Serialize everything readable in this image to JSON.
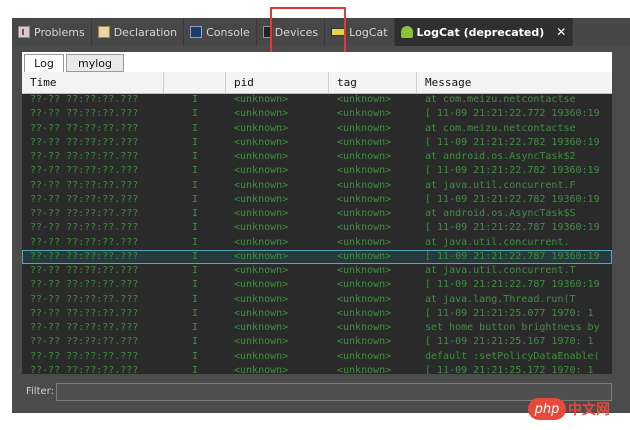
{
  "tabs": [
    {
      "label": "Problems",
      "icon": "problems-icon"
    },
    {
      "label": "Declaration",
      "icon": "declaration-icon"
    },
    {
      "label": "Console",
      "icon": "console-icon"
    },
    {
      "label": "Devices",
      "icon": "devices-icon"
    },
    {
      "label": "LogCat",
      "icon": "logcat-icon"
    },
    {
      "label": "LogCat (deprecated)",
      "icon": "android-icon",
      "close": "✕"
    }
  ],
  "subtabs": {
    "log": "Log",
    "mylog": "mylog"
  },
  "columns": [
    "Time",
    "",
    "pid",
    "tag",
    "Message"
  ],
  "rows": [
    [
      "??-?? ??:??:??.???",
      "I",
      "<unknown>",
      "<unknown>",
      "    at com.meizu.netcontactse"
    ],
    [
      "??-?? ??:??:??.???",
      "I",
      "<unknown>",
      "<unknown>",
      "[ 11-09 21:21:22.772 19360:19"
    ],
    [
      "??-?? ??:??:??.???",
      "I",
      "<unknown>",
      "<unknown>",
      "    at com.meizu.netcontactse"
    ],
    [
      "??-?? ??:??:??.???",
      "I",
      "<unknown>",
      "<unknown>",
      "[ 11-09 21:21:22.782 19360:19"
    ],
    [
      "??-?? ??:??:??.???",
      "I",
      "<unknown>",
      "<unknown>",
      "    at android.os.AsyncTask$2"
    ],
    [
      "??-?? ??:??:??.???",
      "I",
      "<unknown>",
      "<unknown>",
      "[ 11-09 21:21:22.782 19360:19"
    ],
    [
      "??-?? ??:??:??.???",
      "I",
      "<unknown>",
      "<unknown>",
      "    at java.util.concurrent.F"
    ],
    [
      "??-?? ??:??:??.???",
      "I",
      "<unknown>",
      "<unknown>",
      "[ 11-09 21:21:22.782 19360:19"
    ],
    [
      "??-?? ??:??:??.???",
      "I",
      "<unknown>",
      "<unknown>",
      "    at android.os.AsyncTask$S"
    ],
    [
      "??-?? ??:??:??.???",
      "I",
      "<unknown>",
      "<unknown>",
      "[ 11-09 21:21:22.787 19360:19"
    ],
    [
      "??-?? ??:??:??.???",
      "I",
      "<unknown>",
      "<unknown>",
      "    at java.util.concurrent."
    ],
    [
      "??-?? ??:??:??.???",
      "I",
      "<unknown>",
      "<unknown>",
      "[ 11-09 21:21:22.787 19360:19"
    ],
    [
      "??-?? ??:??:??.???",
      "I",
      "<unknown>",
      "<unknown>",
      "    at java.util.concurrent.T"
    ],
    [
      "??-?? ??:??:??.???",
      "I",
      "<unknown>",
      "<unknown>",
      "[ 11-09 21:21:22.787 19360:19"
    ],
    [
      "??-?? ??:??:??.???",
      "I",
      "<unknown>",
      "<unknown>",
      "    at java.lang.Thread.run(T"
    ],
    [
      "??-?? ??:??:??.???",
      "I",
      "<unknown>",
      "<unknown>",
      "[ 11-09 21:21:25.077  1970: 1"
    ],
    [
      "??-?? ??:??:??.???",
      "I",
      "<unknown>",
      "<unknown>",
      "set home button brightness by"
    ],
    [
      "??-?? ??:??:??.???",
      "I",
      "<unknown>",
      "<unknown>",
      "[ 11-09 21:21:25.167  1970: 1"
    ],
    [
      "??-?? ??:??:??.???",
      "I",
      "<unknown>",
      "<unknown>",
      "default :setPolicyDataEnable("
    ],
    [
      "??-?? ??:??:??.???",
      "I",
      "<unknown>",
      "<unknown>",
      "[ 11-09 21:21:25.172  1970: 1"
    ]
  ],
  "selected_row": 11,
  "filter": {
    "label": "Filter:",
    "value": ""
  },
  "watermark": {
    "logo": "php",
    "text": "中文网"
  },
  "colors": {
    "log_text": "#3f8f3f",
    "highlight": "#e53935",
    "watermark": "#e84a3a"
  }
}
